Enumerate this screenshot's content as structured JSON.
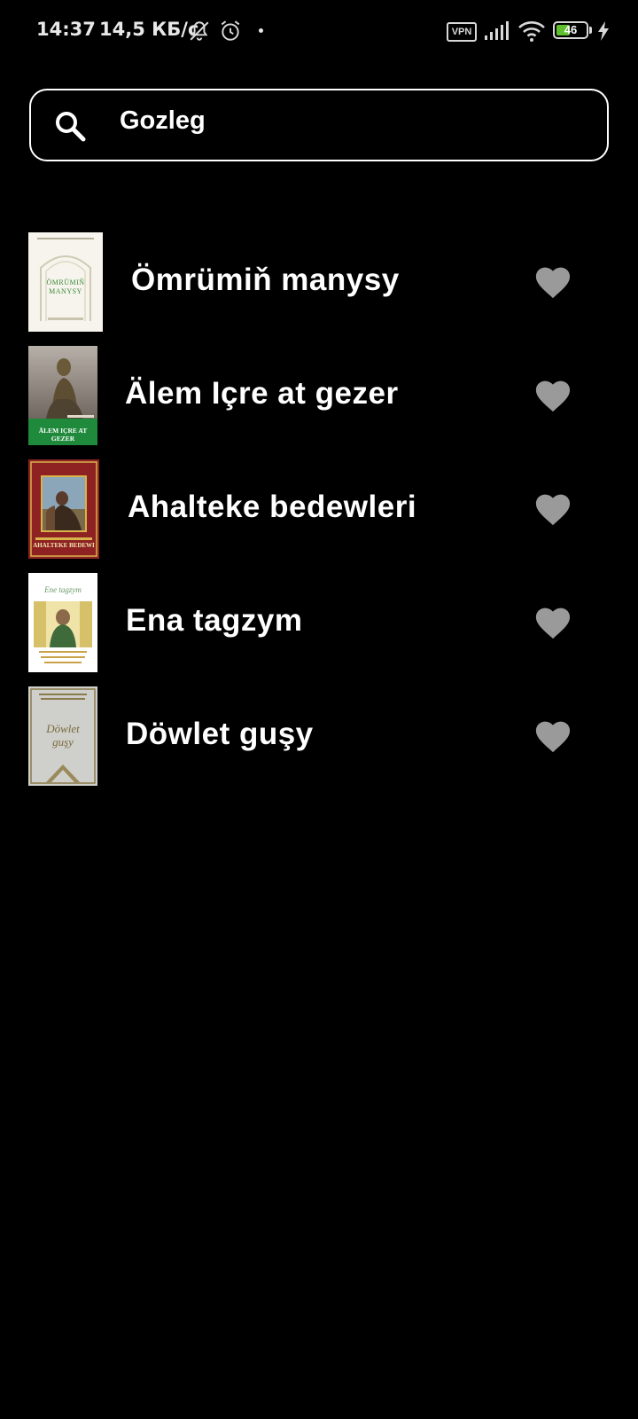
{
  "status_bar": {
    "time": "14:37",
    "net_speed": "14,5 КБ/с",
    "vpn_label": "VPN",
    "battery_level": "46",
    "battery_fraction": 0.46,
    "icons": [
      "bell-muted-icon",
      "alarm-icon",
      "signal-icon",
      "wifi-icon",
      "battery-icon",
      "charging-icon"
    ]
  },
  "search": {
    "placeholder": "Gozleg",
    "icon": "search-icon"
  },
  "books": [
    {
      "title": "Ömrümiň manysy",
      "cover": {
        "title": "ÖMRÜMIŇ MANYSY",
        "bg": "#f6f4ec",
        "accent": "#3d8a3a"
      },
      "favorite_icon": "heart-icon"
    },
    {
      "title": "Älem Içre at gezer",
      "cover": {
        "title": "ÄLEM IÇRE AT GEZER",
        "bg": "#8c8580",
        "accent": "#1f8a3c"
      },
      "favorite_icon": "heart-icon"
    },
    {
      "title": "Ahalteke bedewleri",
      "cover": {
        "title": "AHALTEKE BEDEWI",
        "bg": "#8e2222",
        "accent": "#d8b24a"
      },
      "favorite_icon": "heart-icon"
    },
    {
      "title": "Ena tagzym",
      "cover": {
        "title": "Ene tagzym",
        "bg": "#ffffff",
        "accent": "#d6c06a"
      },
      "favorite_icon": "heart-icon"
    },
    {
      "title": "Döwlet guşy",
      "cover": {
        "title": "Döwlet guşy",
        "bg": "#cfcfcc",
        "accent": "#8a7a4a"
      },
      "favorite_icon": "heart-icon"
    }
  ],
  "colors": {
    "background": "#000000",
    "text": "#ffffff",
    "heart": "#9a9a9a"
  }
}
